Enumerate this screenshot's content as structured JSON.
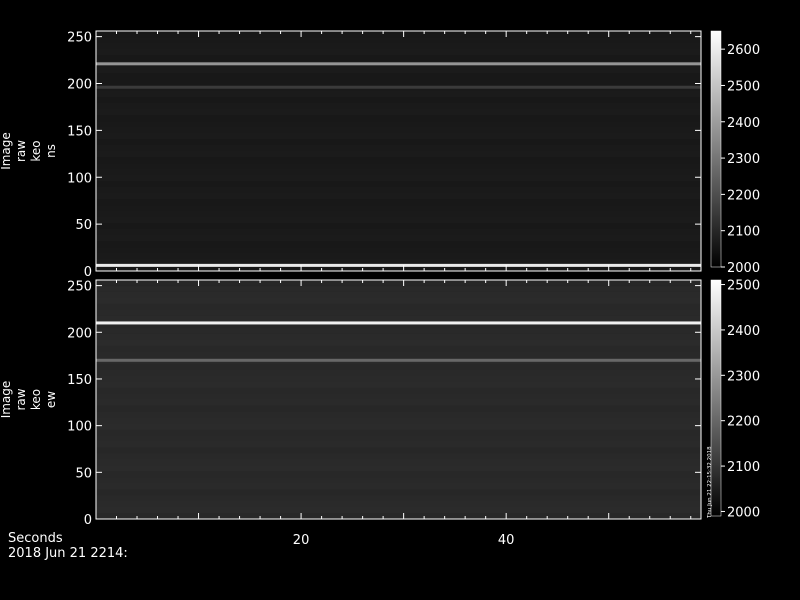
{
  "chart_data": [
    {
      "type": "heatmap",
      "ylabel": [
        "Image",
        "raw",
        "keo",
        "ns"
      ],
      "ylim": [
        0,
        256
      ],
      "yticks": [
        0,
        50,
        100,
        150,
        200,
        250
      ],
      "xlim": [
        0,
        59
      ],
      "colorbar": {
        "range": [
          2000,
          2650
        ],
        "ticks": [
          2000,
          2100,
          2200,
          2300,
          2400,
          2500,
          2600
        ]
      },
      "bright_rows": [
        {
          "y": 221,
          "intensity": 2380
        },
        {
          "y": 196,
          "intensity": 2150
        },
        {
          "y": 6,
          "intensity": 2600
        }
      ]
    },
    {
      "type": "heatmap",
      "ylabel": [
        "Image",
        "raw",
        "keo",
        "ew"
      ],
      "ylim": [
        0,
        256
      ],
      "yticks": [
        0,
        50,
        100,
        150,
        200,
        250
      ],
      "xlim": [
        0,
        59
      ],
      "xticks": [
        20,
        40
      ],
      "colorbar": {
        "range": [
          1990,
          2510
        ],
        "ticks": [
          2000,
          2100,
          2200,
          2300,
          2400,
          2500
        ]
      },
      "bright_rows": [
        {
          "y": 210,
          "intensity": 2480
        },
        {
          "y": 170,
          "intensity": 2200
        }
      ]
    }
  ],
  "footer": {
    "xlabel": "Seconds",
    "date": "2018 Jun 21 2214:",
    "stamp": "Thu Jun 21 22:15:32 2018"
  },
  "colors": {
    "background": "#000000",
    "axis": "#ffffff"
  }
}
